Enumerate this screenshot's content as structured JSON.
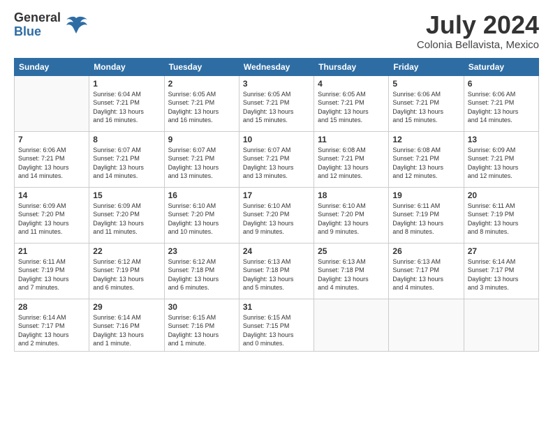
{
  "logo": {
    "general": "General",
    "blue": "Blue"
  },
  "title": "July 2024",
  "location": "Colonia Bellavista, Mexico",
  "days_of_week": [
    "Sunday",
    "Monday",
    "Tuesday",
    "Wednesday",
    "Thursday",
    "Friday",
    "Saturday"
  ],
  "weeks": [
    [
      {
        "day": "",
        "info": ""
      },
      {
        "day": "1",
        "info": "Sunrise: 6:04 AM\nSunset: 7:21 PM\nDaylight: 13 hours\nand 16 minutes."
      },
      {
        "day": "2",
        "info": "Sunrise: 6:05 AM\nSunset: 7:21 PM\nDaylight: 13 hours\nand 16 minutes."
      },
      {
        "day": "3",
        "info": "Sunrise: 6:05 AM\nSunset: 7:21 PM\nDaylight: 13 hours\nand 15 minutes."
      },
      {
        "day": "4",
        "info": "Sunrise: 6:05 AM\nSunset: 7:21 PM\nDaylight: 13 hours\nand 15 minutes."
      },
      {
        "day": "5",
        "info": "Sunrise: 6:06 AM\nSunset: 7:21 PM\nDaylight: 13 hours\nand 15 minutes."
      },
      {
        "day": "6",
        "info": "Sunrise: 6:06 AM\nSunset: 7:21 PM\nDaylight: 13 hours\nand 14 minutes."
      }
    ],
    [
      {
        "day": "7",
        "info": "Sunrise: 6:06 AM\nSunset: 7:21 PM\nDaylight: 13 hours\nand 14 minutes."
      },
      {
        "day": "8",
        "info": "Sunrise: 6:07 AM\nSunset: 7:21 PM\nDaylight: 13 hours\nand 14 minutes."
      },
      {
        "day": "9",
        "info": "Sunrise: 6:07 AM\nSunset: 7:21 PM\nDaylight: 13 hours\nand 13 minutes."
      },
      {
        "day": "10",
        "info": "Sunrise: 6:07 AM\nSunset: 7:21 PM\nDaylight: 13 hours\nand 13 minutes."
      },
      {
        "day": "11",
        "info": "Sunrise: 6:08 AM\nSunset: 7:21 PM\nDaylight: 13 hours\nand 12 minutes."
      },
      {
        "day": "12",
        "info": "Sunrise: 6:08 AM\nSunset: 7:21 PM\nDaylight: 13 hours\nand 12 minutes."
      },
      {
        "day": "13",
        "info": "Sunrise: 6:09 AM\nSunset: 7:21 PM\nDaylight: 13 hours\nand 12 minutes."
      }
    ],
    [
      {
        "day": "14",
        "info": "Sunrise: 6:09 AM\nSunset: 7:20 PM\nDaylight: 13 hours\nand 11 minutes."
      },
      {
        "day": "15",
        "info": "Sunrise: 6:09 AM\nSunset: 7:20 PM\nDaylight: 13 hours\nand 11 minutes."
      },
      {
        "day": "16",
        "info": "Sunrise: 6:10 AM\nSunset: 7:20 PM\nDaylight: 13 hours\nand 10 minutes."
      },
      {
        "day": "17",
        "info": "Sunrise: 6:10 AM\nSunset: 7:20 PM\nDaylight: 13 hours\nand 9 minutes."
      },
      {
        "day": "18",
        "info": "Sunrise: 6:10 AM\nSunset: 7:20 PM\nDaylight: 13 hours\nand 9 minutes."
      },
      {
        "day": "19",
        "info": "Sunrise: 6:11 AM\nSunset: 7:19 PM\nDaylight: 13 hours\nand 8 minutes."
      },
      {
        "day": "20",
        "info": "Sunrise: 6:11 AM\nSunset: 7:19 PM\nDaylight: 13 hours\nand 8 minutes."
      }
    ],
    [
      {
        "day": "21",
        "info": "Sunrise: 6:11 AM\nSunset: 7:19 PM\nDaylight: 13 hours\nand 7 minutes."
      },
      {
        "day": "22",
        "info": "Sunrise: 6:12 AM\nSunset: 7:19 PM\nDaylight: 13 hours\nand 6 minutes."
      },
      {
        "day": "23",
        "info": "Sunrise: 6:12 AM\nSunset: 7:18 PM\nDaylight: 13 hours\nand 6 minutes."
      },
      {
        "day": "24",
        "info": "Sunrise: 6:13 AM\nSunset: 7:18 PM\nDaylight: 13 hours\nand 5 minutes."
      },
      {
        "day": "25",
        "info": "Sunrise: 6:13 AM\nSunset: 7:18 PM\nDaylight: 13 hours\nand 4 minutes."
      },
      {
        "day": "26",
        "info": "Sunrise: 6:13 AM\nSunset: 7:17 PM\nDaylight: 13 hours\nand 4 minutes."
      },
      {
        "day": "27",
        "info": "Sunrise: 6:14 AM\nSunset: 7:17 PM\nDaylight: 13 hours\nand 3 minutes."
      }
    ],
    [
      {
        "day": "28",
        "info": "Sunrise: 6:14 AM\nSunset: 7:17 PM\nDaylight: 13 hours\nand 2 minutes."
      },
      {
        "day": "29",
        "info": "Sunrise: 6:14 AM\nSunset: 7:16 PM\nDaylight: 13 hours\nand 1 minute."
      },
      {
        "day": "30",
        "info": "Sunrise: 6:15 AM\nSunset: 7:16 PM\nDaylight: 13 hours\nand 1 minute."
      },
      {
        "day": "31",
        "info": "Sunrise: 6:15 AM\nSunset: 7:15 PM\nDaylight: 13 hours\nand 0 minutes."
      },
      {
        "day": "",
        "info": ""
      },
      {
        "day": "",
        "info": ""
      },
      {
        "day": "",
        "info": ""
      }
    ]
  ]
}
